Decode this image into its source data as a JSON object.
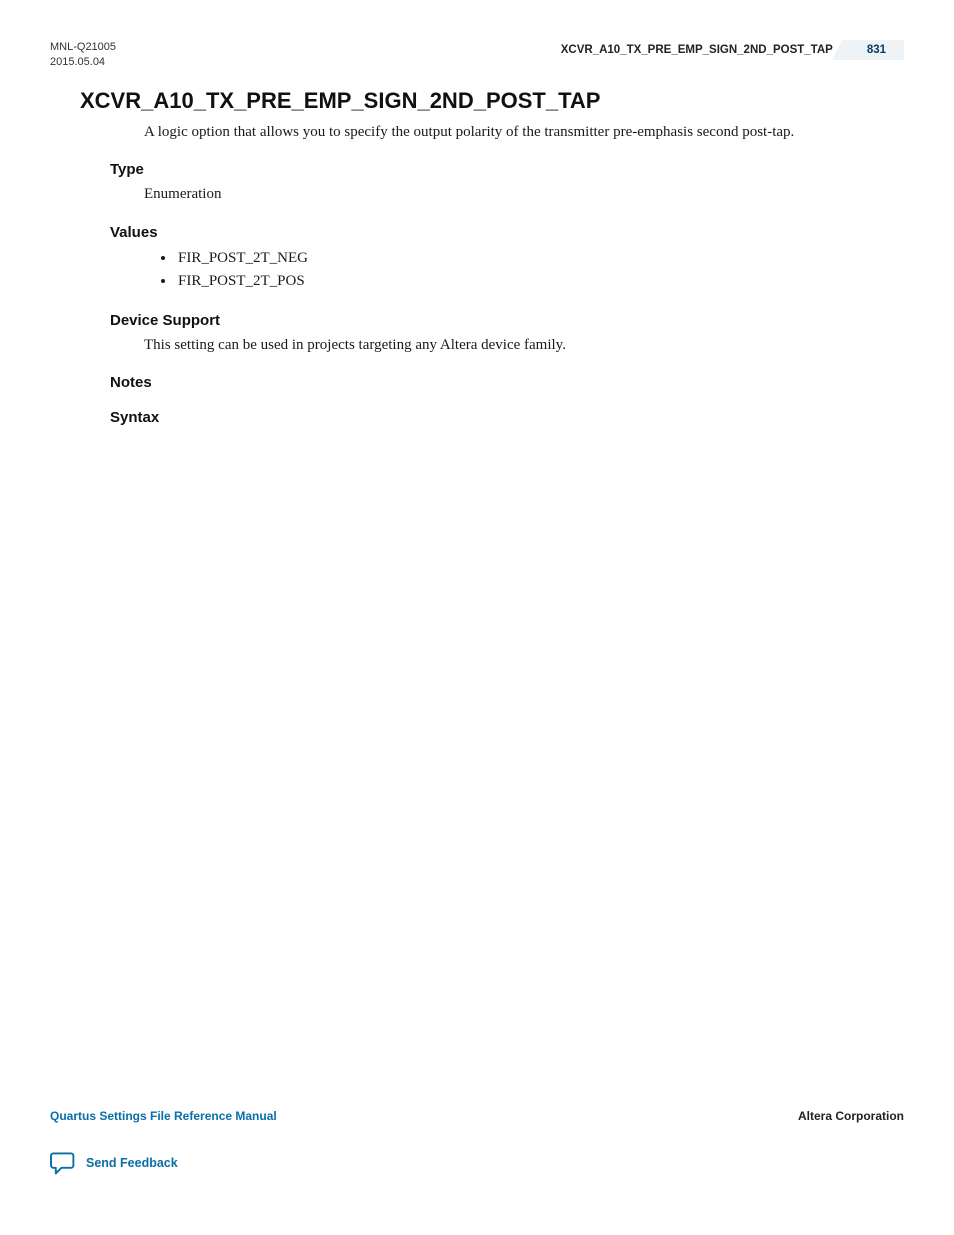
{
  "header": {
    "doc_id": "MNL-Q21005",
    "date": "2015.05.04",
    "running_title": "XCVR_A10_TX_PRE_EMP_SIGN_2ND_POST_TAP",
    "page_number": "831"
  },
  "title": "XCVR_A10_TX_PRE_EMP_SIGN_2ND_POST_TAP",
  "intro": "A logic option that allows you to specify the output polarity of the transmitter pre-emphasis second post-tap.",
  "sections": {
    "type": {
      "heading": "Type",
      "body": "Enumeration"
    },
    "values": {
      "heading": "Values",
      "items": [
        "FIR_POST_2T_NEG",
        "FIR_POST_2T_POS"
      ]
    },
    "device_support": {
      "heading": "Device Support",
      "body": "This setting can be used in projects targeting any Altera device family."
    },
    "notes": {
      "heading": "Notes"
    },
    "syntax": {
      "heading": "Syntax"
    }
  },
  "footer": {
    "manual": "Quartus Settings File Reference Manual",
    "company": "Altera Corporation",
    "feedback": "Send Feedback"
  }
}
